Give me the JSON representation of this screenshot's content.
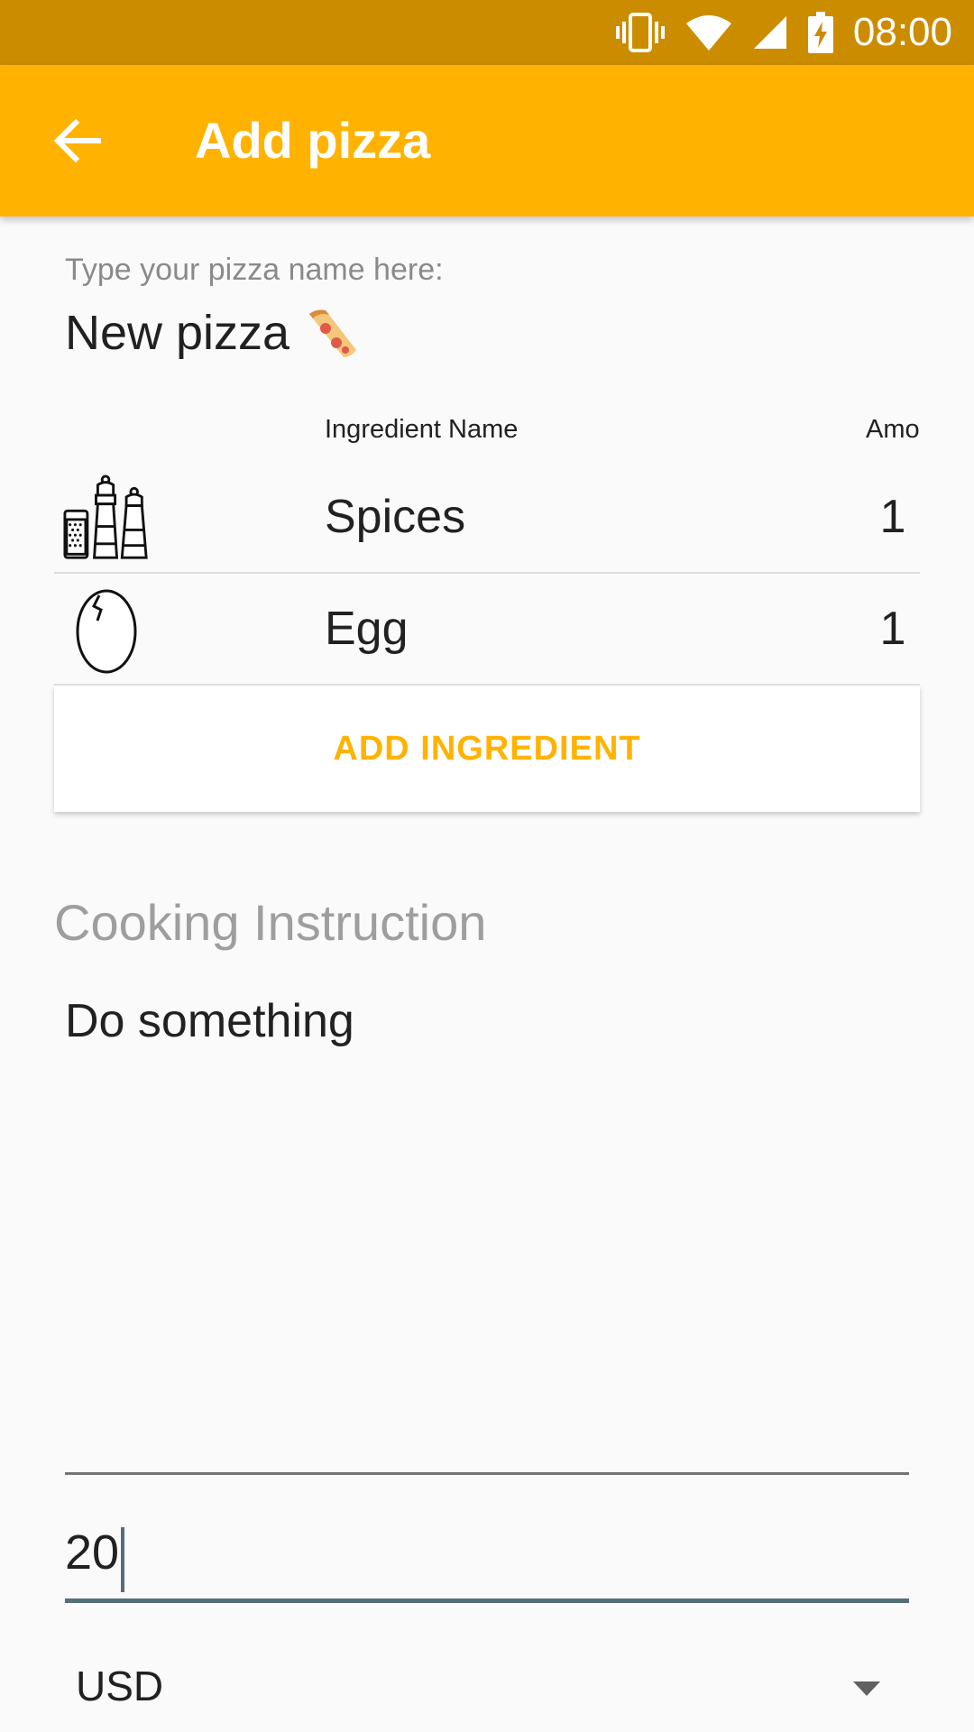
{
  "status_bar": {
    "time": "08:00",
    "icons": [
      "vibrate-icon",
      "wifi-icon",
      "cell-signal-icon",
      "battery-charging-icon"
    ]
  },
  "app_bar": {
    "title": "Add pizza",
    "back_icon": "arrow-back-icon",
    "color": "#ffb300"
  },
  "pizza_name": {
    "label": "Type your pizza name here:",
    "value": "New pizza",
    "emoji_icon": "pizza-slice-icon"
  },
  "ingredients": {
    "columns": [
      "Ingredient Name",
      "Amo"
    ],
    "rows": [
      {
        "icon": "salt-pepper-shakers-icon",
        "name": "Spices",
        "amount": "1"
      },
      {
        "icon": "egg-icon",
        "name": "Egg",
        "amount": "1"
      }
    ],
    "add_button_label": "ADD INGREDIENT"
  },
  "cooking": {
    "title": "Cooking Instruction",
    "text": "Do something"
  },
  "price": {
    "value": "20"
  },
  "currency": {
    "selected": "USD",
    "icon": "dropdown-arrow-icon"
  },
  "colors": {
    "status_bar": "#cc8c00",
    "accent": "#ffb300",
    "input_line": "#546e7a"
  }
}
